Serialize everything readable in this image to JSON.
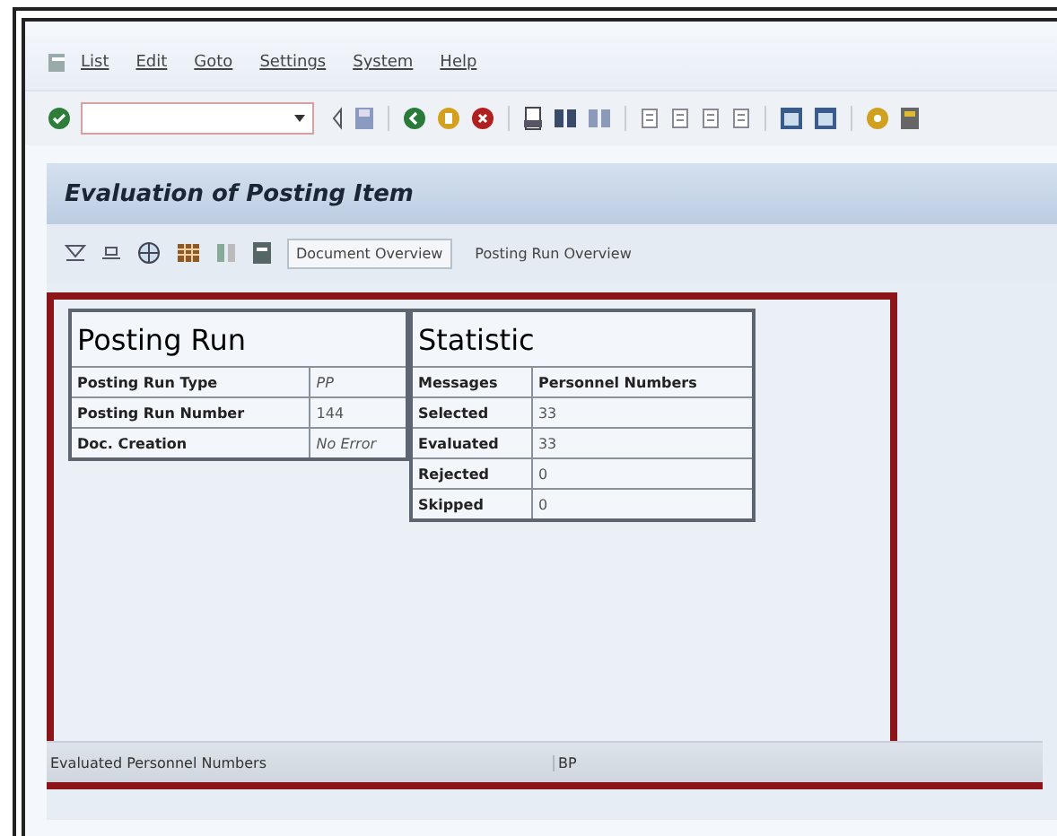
{
  "menu": [
    "List",
    "Edit",
    "Goto",
    "Settings",
    "System",
    "Help"
  ],
  "title": "Evaluation of Posting Item",
  "app_toolbar": [
    {
      "label": "Document Overview",
      "selected": true
    },
    {
      "label": "Posting Run Overview",
      "selected": false
    }
  ],
  "posting_run": {
    "heading": "Posting Run",
    "rows": [
      {
        "label": "Posting Run Type",
        "value": "PP",
        "italic": true
      },
      {
        "label": "Posting Run Number",
        "value": "144",
        "italic": false
      },
      {
        "label": "Doc. Creation",
        "value": "No Error",
        "italic": true
      }
    ]
  },
  "statistic": {
    "heading": "Statistic",
    "columns": [
      "Messages",
      "Personnel Numbers"
    ],
    "rows": [
      [
        "Selected",
        "33"
      ],
      [
        "Evaluated",
        "33"
      ],
      [
        "Rejected",
        "0"
      ],
      [
        "Skipped",
        "0"
      ]
    ]
  },
  "list": {
    "columns": [
      "Evaluated Personnel Numbers",
      "BP"
    ]
  }
}
